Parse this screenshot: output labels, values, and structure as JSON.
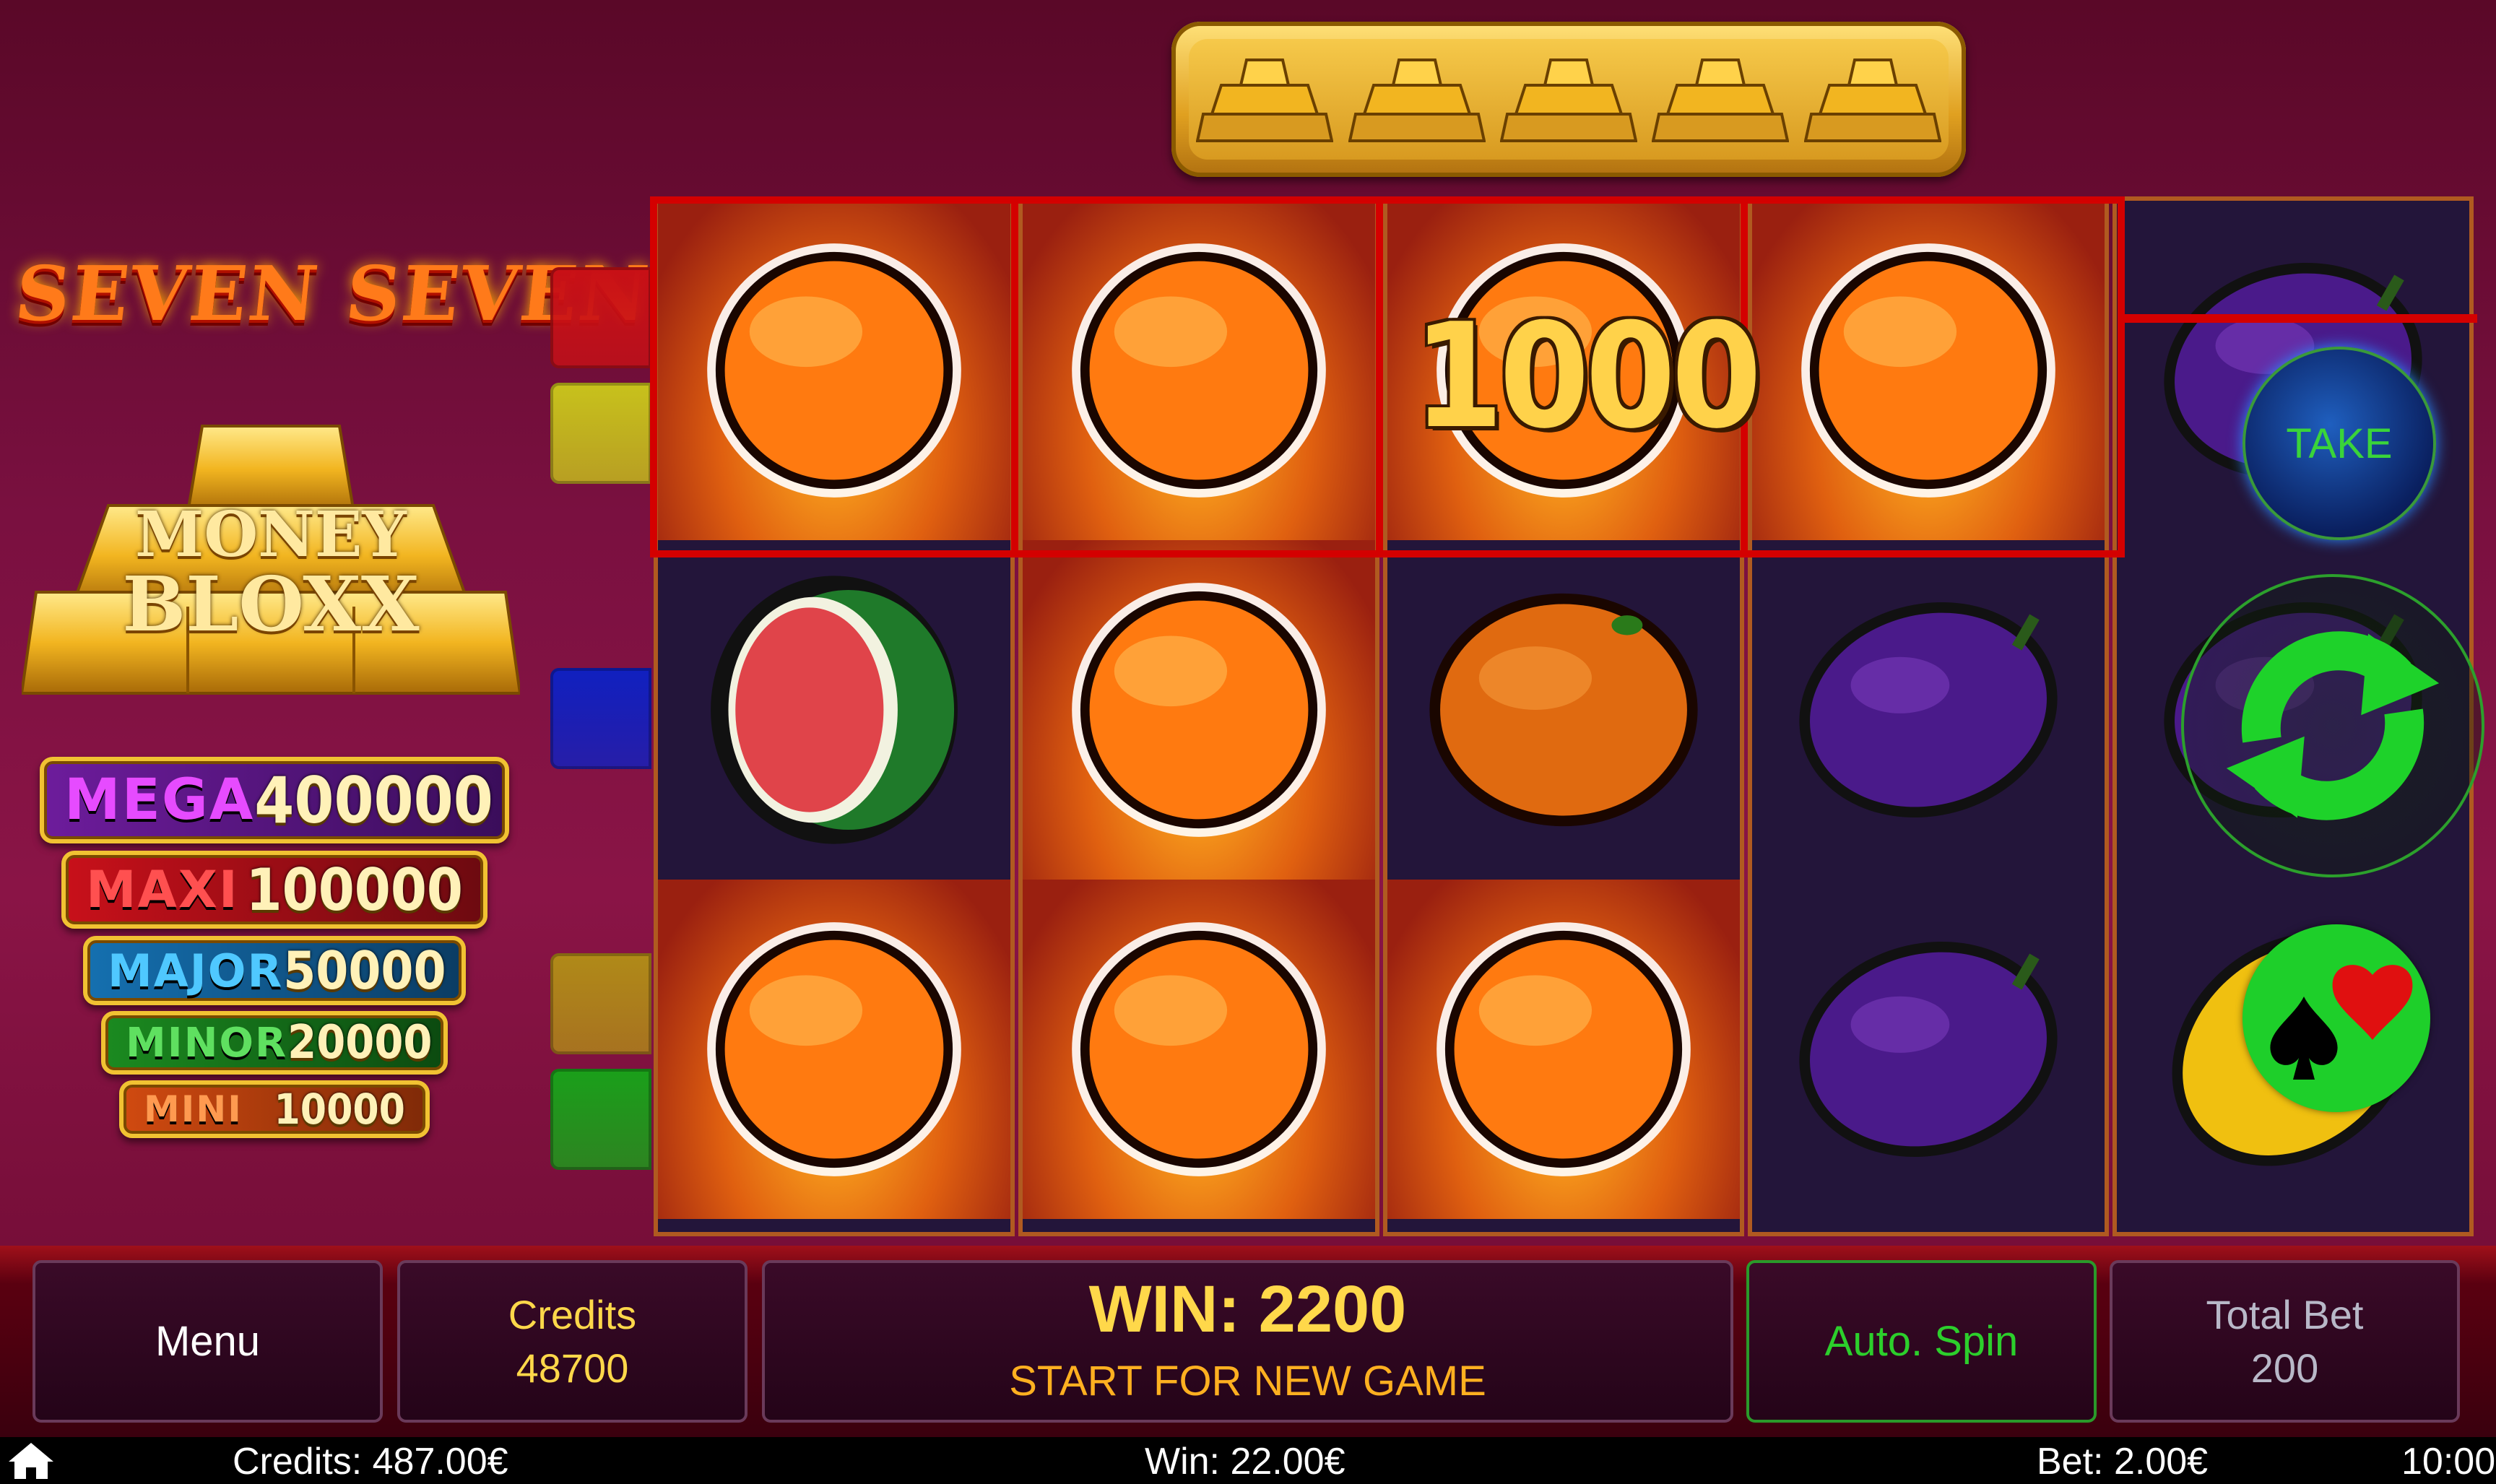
{
  "logo": {
    "title": "SEVEN SEVEN"
  },
  "bloxx": {
    "line1": "MONEY",
    "line2": "BLOXX"
  },
  "jackpots": [
    {
      "name": "MEGA",
      "value": "400000"
    },
    {
      "name": "MAXI",
      "value": "100000"
    },
    {
      "name": "MAJOR",
      "value": "50000"
    },
    {
      "name": "MINOR",
      "value": "20000"
    },
    {
      "name": "MINI",
      "value": "10000"
    }
  ],
  "side_tabs": [
    "#c81016",
    "#c8c21c",
    "#1020c0",
    "#b08a18",
    "#1aa01a"
  ],
  "gold_bars_collected": 5,
  "reels": [
    [
      "orange-fire",
      "watermelon",
      "orange-fire"
    ],
    [
      "orange-fire",
      "orange-fire",
      "orange-fire"
    ],
    [
      "orange-fire",
      "orange",
      "orange-fire"
    ],
    [
      "orange-fire",
      "plum",
      "plum"
    ],
    [
      "plum",
      "plum",
      "lemon"
    ]
  ],
  "reel_win_value": "1000",
  "buttons": {
    "take": "TAKE",
    "spin_icon": "refresh-icon",
    "gamble_icon": "card-suits-icon"
  },
  "panel": {
    "menu": "Menu",
    "credits_label": "Credits",
    "credits_value": "48700",
    "win_text": "WIN: 2200",
    "win_sub": "START FOR NEW GAME",
    "auto_spin": "Auto. Spin",
    "total_bet_label": "Total Bet",
    "total_bet_value": "200"
  },
  "status": {
    "credits": "Credits: 487.00€",
    "win": "Win: 22.00€",
    "bet": "Bet: 2.00€",
    "time": "10:00"
  },
  "colors": {
    "win_line": "#d40000",
    "accent_gold": "#ffd84a",
    "auto_green": "#2ccf2c"
  }
}
